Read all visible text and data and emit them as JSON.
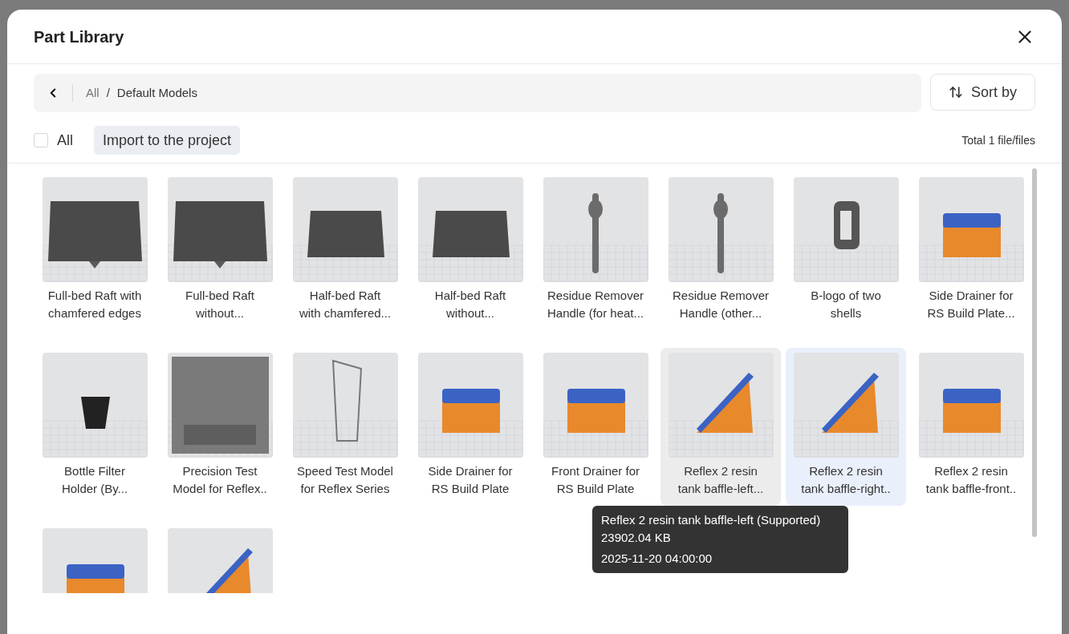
{
  "dialog": {
    "title": "Part Library"
  },
  "breadcrumb": {
    "items": [
      "All",
      "Default Models"
    ],
    "separator": "/"
  },
  "sort_button": {
    "label": "Sort by"
  },
  "select_all": {
    "label": "All",
    "checked": false
  },
  "import_button": {
    "label": "Import to the project"
  },
  "total": "Total 1 file/files",
  "items": [
    {
      "kind": "raft",
      "lines": [
        "Full-bed Raft with",
        "chamfered edges"
      ],
      "selected": false,
      "hovered": false
    },
    {
      "kind": "raft",
      "lines": [
        "Full-bed Raft",
        "without..."
      ],
      "selected": false,
      "hovered": false
    },
    {
      "kind": "half-raft",
      "lines": [
        "Half-bed Raft",
        "with chamfered..."
      ],
      "selected": false,
      "hovered": false
    },
    {
      "kind": "half-raft",
      "lines": [
        "Half-bed Raft",
        "without..."
      ],
      "selected": false,
      "hovered": false
    },
    {
      "kind": "handle",
      "lines": [
        "Residue Remover",
        "Handle (for heat..."
      ],
      "selected": false,
      "hovered": false
    },
    {
      "kind": "handle",
      "lines": [
        "Residue Remover",
        "Handle (other..."
      ],
      "selected": false,
      "hovered": false
    },
    {
      "kind": "logo",
      "lines": [
        "B-logo of two",
        "shells"
      ],
      "selected": false,
      "hovered": false
    },
    {
      "kind": "supported",
      "lines": [
        "Side Drainer for",
        "RS Build Plate..."
      ],
      "selected": false,
      "hovered": false
    },
    {
      "kind": "filter",
      "lines": [
        "Bottle Filter",
        "Holder (By..."
      ],
      "selected": false,
      "hovered": false
    },
    {
      "kind": "test",
      "lines": [
        "Precision Test",
        "Model for Reflex.."
      ],
      "selected": false,
      "hovered": false
    },
    {
      "kind": "tower",
      "lines": [
        "Speed Test Model",
        "for Reflex Series"
      ],
      "selected": false,
      "hovered": false
    },
    {
      "kind": "supported",
      "lines": [
        "Side Drainer for",
        "RS Build Plate"
      ],
      "selected": false,
      "hovered": false
    },
    {
      "kind": "supported",
      "lines": [
        "Front Drainer for",
        "RS Build Plate"
      ],
      "selected": false,
      "hovered": false
    },
    {
      "kind": "ramp",
      "lines": [
        "Reflex 2 resin",
        "tank baffle-left..."
      ],
      "selected": false,
      "hovered": true
    },
    {
      "kind": "ramp",
      "lines": [
        "Reflex 2 resin",
        "tank baffle-right.."
      ],
      "selected": true,
      "hovered": false
    },
    {
      "kind": "supported",
      "lines": [
        "Reflex 2 resin",
        "tank baffle-front.."
      ],
      "selected": false,
      "hovered": false
    },
    {
      "kind": "supported",
      "selected": false,
      "hovered": false
    },
    {
      "kind": "ramp",
      "selected": false,
      "hovered": false
    }
  ],
  "tooltip": {
    "title": "Reflex 2 resin tank baffle-left (Supported)",
    "size": "23902.04 KB",
    "date": "2025-11-20 04:00:00"
  }
}
